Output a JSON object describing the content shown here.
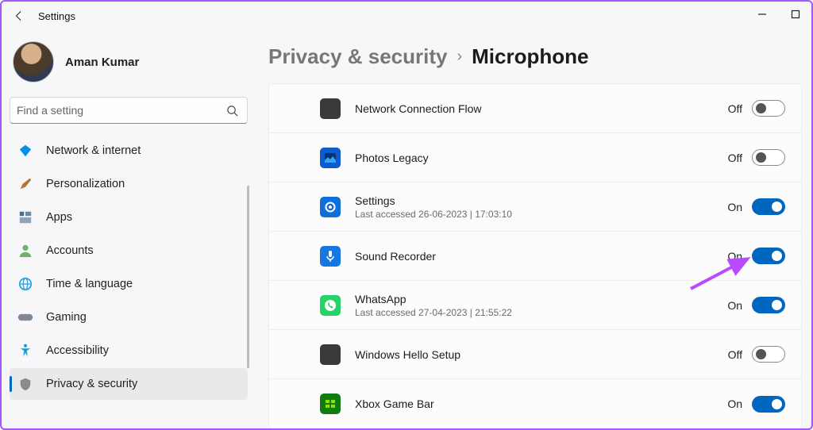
{
  "window": {
    "title": "Settings"
  },
  "profile": {
    "name": "Aman Kumar"
  },
  "search": {
    "placeholder": "Find a setting"
  },
  "sidebar": {
    "items": [
      {
        "label": "Network & internet",
        "icon": "diamond",
        "color": "#0093e9"
      },
      {
        "label": "Personalization",
        "icon": "brush",
        "color": "#b87333"
      },
      {
        "label": "Apps",
        "icon": "apps",
        "color": "#4a6d8c"
      },
      {
        "label": "Accounts",
        "icon": "person",
        "color": "#6fb26f"
      },
      {
        "label": "Time & language",
        "icon": "globe",
        "color": "#2aa4e3"
      },
      {
        "label": "Gaming",
        "icon": "gamepad",
        "color": "#7c8896"
      },
      {
        "label": "Accessibility",
        "icon": "accessibility",
        "color": "#0aa0d6"
      },
      {
        "label": "Privacy & security",
        "icon": "shield",
        "color": "#8b8b8b",
        "active": true
      }
    ]
  },
  "breadcrumb": {
    "root": "Privacy & security",
    "leaf": "Microphone"
  },
  "apps": [
    {
      "name": "Network Connection Flow",
      "sub": "",
      "on": false,
      "icon": "square",
      "bg": "#3a3a3a"
    },
    {
      "name": "Photos Legacy",
      "sub": "",
      "on": false,
      "icon": "photo",
      "bg": "#0b5bd1"
    },
    {
      "name": "Settings",
      "sub": "Last accessed 26-06-2023 | 17:03:10",
      "on": true,
      "icon": "gear",
      "bg": "#0e6fd8"
    },
    {
      "name": "Sound Recorder",
      "sub": "",
      "on": true,
      "icon": "mic",
      "bg": "#1677e0"
    },
    {
      "name": "WhatsApp",
      "sub": "Last accessed 27-04-2023 | 21:55:22",
      "on": true,
      "icon": "whatsapp",
      "bg": "#25d366"
    },
    {
      "name": "Windows Hello Setup",
      "sub": "",
      "on": false,
      "icon": "square",
      "bg": "#3a3a3a"
    },
    {
      "name": "Xbox Game Bar",
      "sub": "",
      "on": true,
      "icon": "xbox",
      "bg": "#107c10"
    }
  ],
  "states": {
    "on": "On",
    "off": "Off"
  },
  "annotation_arrow_color": "#b84bff"
}
